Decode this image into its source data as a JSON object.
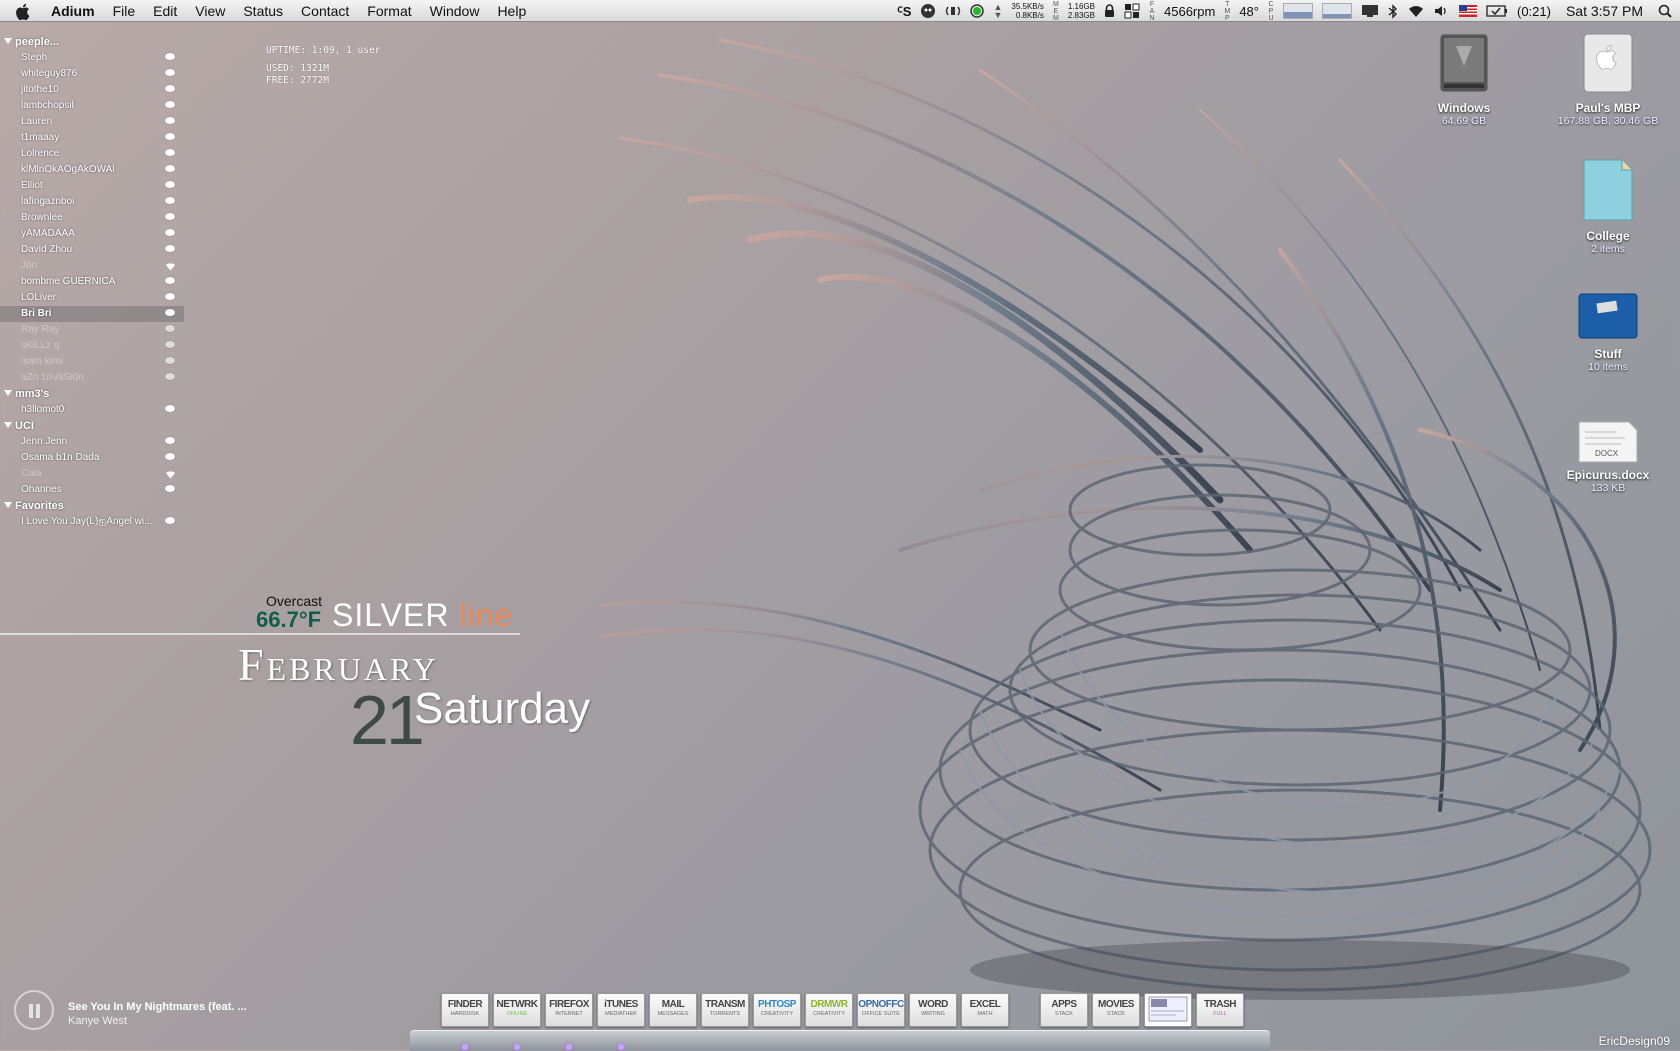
{
  "menubar": {
    "app_name": "Adium",
    "menus": [
      "File",
      "Edit",
      "View",
      "Status",
      "Contact",
      "Format",
      "Window",
      "Help"
    ],
    "status": {
      "net_up": "35.5KB/s",
      "net_down": "0.8KB/s",
      "mem_used": "1.16GB",
      "mem_free": "2.83GB",
      "fan": "4566rpm",
      "temp": "48°",
      "battery_time": "(0:21)",
      "clock": "Sat 3:57 PM"
    }
  },
  "buddylist": {
    "groups": [
      {
        "name": "peeple...",
        "buddies": [
          {
            "name": "Steph",
            "status": "available"
          },
          {
            "name": "whiteguy876",
            "status": "available"
          },
          {
            "name": "jitothe10",
            "status": "available"
          },
          {
            "name": "lambchopsil",
            "status": "available"
          },
          {
            "name": "Lauren",
            "status": "available"
          },
          {
            "name": "t1maaay",
            "status": "available"
          },
          {
            "name": "Lolrence",
            "status": "available"
          },
          {
            "name": "klMlnOkAOgAkOWAl",
            "status": "available"
          },
          {
            "name": "Elliot",
            "status": "available"
          },
          {
            "name": "lafingaznboi",
            "status": "available"
          },
          {
            "name": "Brownlee",
            "status": "available"
          },
          {
            "name": "yAMADAAA",
            "status": "available"
          },
          {
            "name": "David Zhou",
            "status": "available"
          },
          {
            "name": "Jon",
            "status": "mobile"
          },
          {
            "name": "bombme  GUERNICA",
            "status": "available"
          },
          {
            "name": "LOLiver",
            "status": "available"
          },
          {
            "name": "Bri Bri",
            "status": "available",
            "selected": true
          },
          {
            "name": "Ray Ray",
            "status": "away"
          },
          {
            "name": "sKiLLz q",
            "status": "away"
          },
          {
            "name": "isam kimi",
            "status": "away"
          },
          {
            "name": "aZn 1nVaSi0n",
            "status": "away"
          }
        ]
      },
      {
        "name": "mm3's",
        "buddies": [
          {
            "name": "h3llomot0",
            "status": "available"
          }
        ]
      },
      {
        "name": "UCI",
        "buddies": [
          {
            "name": "Jenn Jenn",
            "status": "available"
          },
          {
            "name": "Osama b1n Dada",
            "status": "available"
          },
          {
            "name": "Caia",
            "status": "mobile"
          },
          {
            "name": "Ohannes",
            "status": "available"
          }
        ]
      },
      {
        "name": "Favorites",
        "buddies": [
          {
            "name": "I Love You Jay(L)ஐAngel wi...",
            "status": "available"
          }
        ]
      }
    ]
  },
  "sysinfo": {
    "uptime": "UPTIME: 1:09, 1 user",
    "used": "USED: 1321M",
    "free": "FREE: 2772M"
  },
  "weather": {
    "condition": "Overcast",
    "temperature": "66.7°F",
    "brand_a": "SILVER",
    "brand_b": "line",
    "month": "February",
    "day": "21",
    "weekday": "Saturday"
  },
  "desktop_icons": [
    {
      "label": "Windows",
      "sub": "64.69 GB",
      "icon": "hard-drive-icon"
    },
    {
      "label": "Paul's MBP",
      "sub": "167.88 GB, 30.46 GB",
      "icon": "apple-drive-icon"
    },
    {
      "label": "College",
      "sub": "2 items",
      "icon": "document-icon"
    },
    {
      "label": "Stuff",
      "sub": "10 items",
      "icon": "blue-folder-icon"
    },
    {
      "label": "Epicurus.docx",
      "sub": "133 KB",
      "icon": "docx-icon",
      "badge": "DOCX"
    }
  ],
  "nowplaying": {
    "song": "See You In My Nightmares (feat. ...",
    "artist": "Kanye West"
  },
  "dock": [
    {
      "title": "FINDER",
      "sub": "HARDDISK",
      "color": "#444444"
    },
    {
      "title": "NETWRK",
      "sub": "ONLINE",
      "color": "#444444",
      "bar": "#6cc04a"
    },
    {
      "title": "FIREFOX",
      "sub": "INTERNET",
      "color": "#444444"
    },
    {
      "title": "iTUNES",
      "sub": "MEDIATHEK",
      "color": "#444444"
    },
    {
      "title": "MAIL",
      "sub": "MESSAGES",
      "color": "#444444"
    },
    {
      "title": "TRANSM",
      "sub": "TORRENTS",
      "color": "#444444"
    },
    {
      "title": "PHTOSP",
      "sub": "CREATIVITY",
      "color": "#2f86c6"
    },
    {
      "title": "DRMWR",
      "sub": "CREATIVITY",
      "color": "#8db62e"
    },
    {
      "title": "OPNOFFC",
      "sub": "OFFICE SUITE",
      "color": "#3a6aa0"
    },
    {
      "title": "WORD",
      "sub": "WRITING",
      "color": "#444444"
    },
    {
      "title": "EXCEL",
      "sub": "MATH",
      "color": "#444444"
    },
    {
      "title": "APPS",
      "sub": "STACK",
      "color": "#444444"
    },
    {
      "title": "MOVIES",
      "sub": "STACK",
      "color": "#444444"
    },
    {
      "title": "",
      "sub": "",
      "color": "#444444",
      "preview": true
    },
    {
      "title": "TRASH",
      "sub": "FULL",
      "color": "#444444",
      "bar": "#c050c0"
    }
  ],
  "signature": "EricDesign09"
}
